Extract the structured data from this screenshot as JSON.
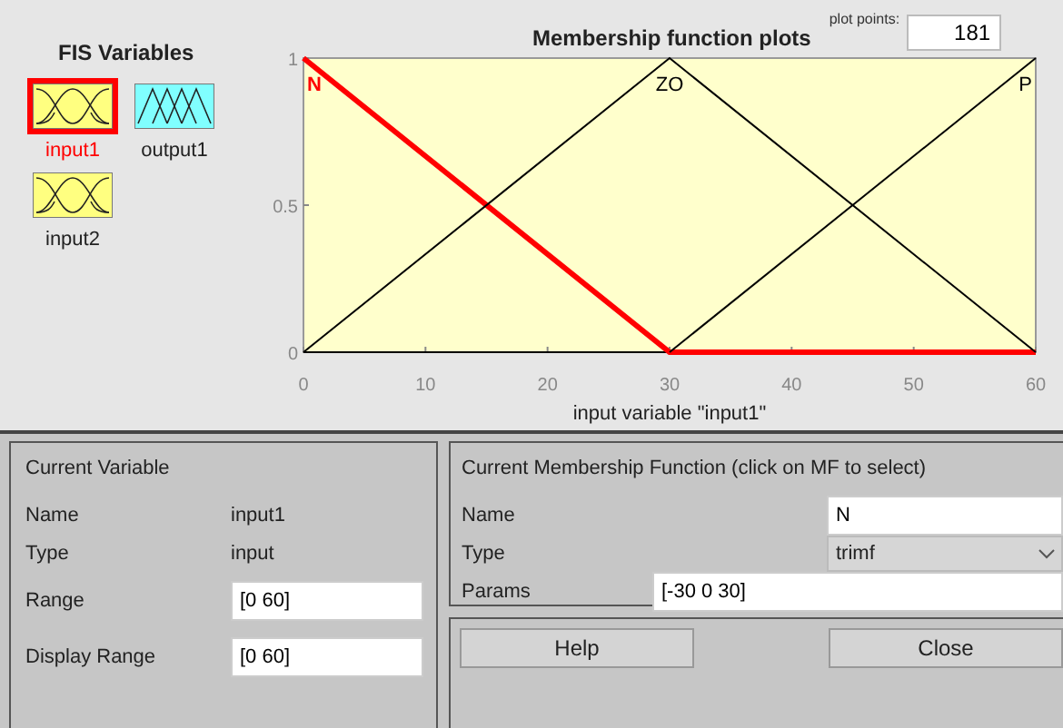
{
  "fis_variables": {
    "title": "FIS Variables",
    "items": [
      {
        "name": "input1",
        "kind": "input",
        "selected": true
      },
      {
        "name": "output1",
        "kind": "output",
        "selected": false
      },
      {
        "name": "input2",
        "kind": "input",
        "selected": false
      }
    ]
  },
  "plot": {
    "title": "Membership function plots",
    "plot_points_label": "plot points:",
    "plot_points": "181",
    "chart_data": {
      "type": "line",
      "xlabel": "input variable \"input1\"",
      "x": [
        0,
        30,
        60
      ],
      "series": [
        {
          "name": "N",
          "color": "#ff0000",
          "values": [
            1,
            0,
            0
          ]
        },
        {
          "name": "ZO",
          "color": "#000000",
          "values": [
            0,
            1,
            0
          ]
        },
        {
          "name": "P",
          "color": "#000000",
          "values": [
            null,
            0,
            1
          ]
        }
      ],
      "xlim": [
        0,
        60
      ],
      "ylim": [
        0,
        1
      ],
      "xticks": [
        0,
        10,
        20,
        30,
        40,
        50,
        60
      ],
      "yticks": [
        0,
        0.5,
        1
      ]
    }
  },
  "current_variable": {
    "title": "Current Variable",
    "name_label": "Name",
    "name": "input1",
    "type_label": "Type",
    "type": "input",
    "range_label": "Range",
    "range": "[0 60]",
    "display_range_label": "Display Range",
    "display_range": "[0 60]"
  },
  "current_mf": {
    "title": "Current Membership Function (click on MF to select)",
    "name_label": "Name",
    "name": "N",
    "type_label": "Type",
    "type": "trimf",
    "params_label": "Params",
    "params": "[-30 0 30]"
  },
  "buttons": [
    "Help",
    "Close"
  ]
}
